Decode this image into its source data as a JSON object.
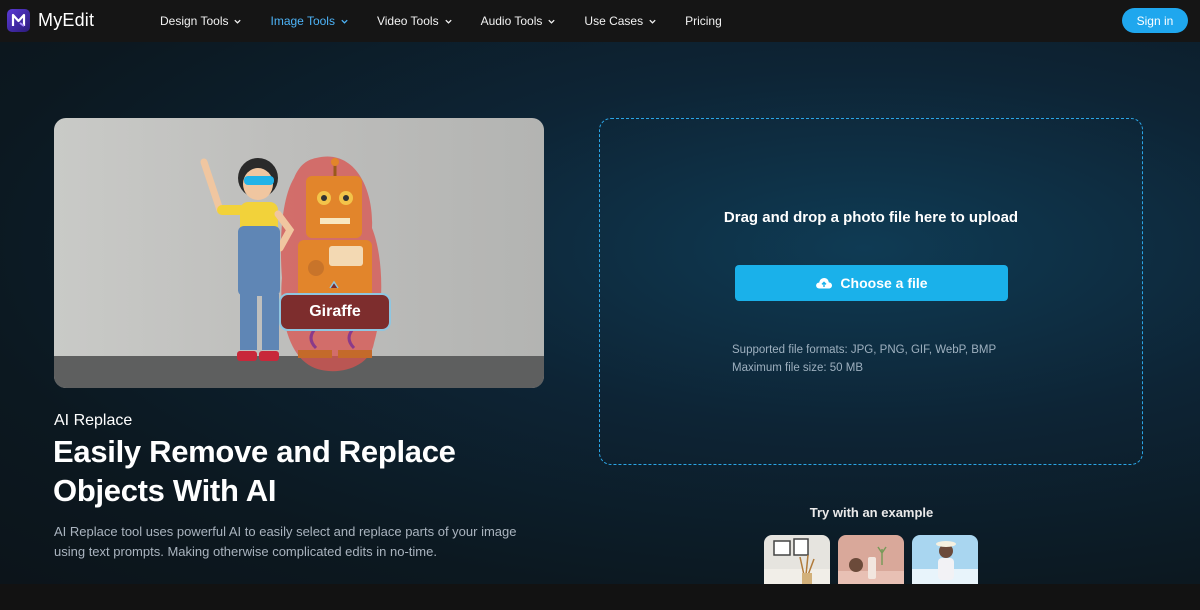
{
  "brand": {
    "name": "MyEdit"
  },
  "nav": {
    "items": [
      {
        "label": "Design Tools",
        "has_dropdown": true,
        "active": false
      },
      {
        "label": "Image Tools",
        "has_dropdown": true,
        "active": true
      },
      {
        "label": "Video Tools",
        "has_dropdown": true,
        "active": false
      },
      {
        "label": "Audio Tools",
        "has_dropdown": true,
        "active": false
      },
      {
        "label": "Use Cases",
        "has_dropdown": true,
        "active": false
      },
      {
        "label": "Pricing",
        "has_dropdown": false,
        "active": false
      }
    ],
    "sign_in": "Sign in"
  },
  "hero": {
    "image_tag": "Giraffe",
    "eyebrow": "AI Replace",
    "headline": "Easily Remove and Replace Objects With AI",
    "description": "AI Replace tool uses powerful AI to easily select and replace parts of your image using text prompts. Making otherwise complicated edits in no-time."
  },
  "upload": {
    "title": "Drag and drop a photo file here to upload",
    "button_label": "Choose a file",
    "formats": "Supported file formats: JPG, PNG, GIF, WebP, BMP",
    "max_size": "Maximum file size: 50 MB"
  },
  "examples": {
    "title": "Try with an example",
    "thumbs": [
      "example-interior",
      "example-product",
      "example-portrait"
    ]
  },
  "colors": {
    "accent": "#1ab1ea",
    "nav_active": "#4db3f7",
    "nav_bg": "#151515",
    "dashed_border": "#2ba6e6"
  }
}
